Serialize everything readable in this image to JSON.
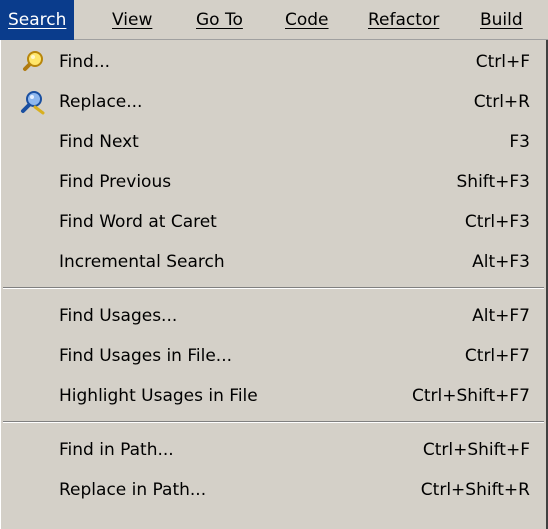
{
  "menubar": {
    "items": [
      "Search",
      "View",
      "Go To",
      "Code",
      "Refactor",
      "Build"
    ]
  },
  "menu": {
    "items": [
      {
        "label": "Find...",
        "shortcut": "Ctrl+F",
        "icon": "find-icon"
      },
      {
        "label": "Replace...",
        "shortcut": "Ctrl+R",
        "icon": "replace-icon"
      },
      {
        "label": "Find Next",
        "shortcut": "F3"
      },
      {
        "label": "Find Previous",
        "shortcut": "Shift+F3"
      },
      {
        "label": "Find Word at Caret",
        "shortcut": "Ctrl+F3"
      },
      {
        "label": "Incremental Search",
        "shortcut": "Alt+F3"
      },
      {
        "label": "Find Usages...",
        "shortcut": "Alt+F7"
      },
      {
        "label": "Find Usages in File...",
        "shortcut": "Ctrl+F7"
      },
      {
        "label": "Highlight Usages in File",
        "shortcut": "Ctrl+Shift+F7"
      },
      {
        "label": "Find in Path...",
        "shortcut": "Ctrl+Shift+F"
      },
      {
        "label": "Replace in Path...",
        "shortcut": "Ctrl+Shift+R"
      }
    ]
  },
  "colors": {
    "menu_background": "#d4d0c8",
    "active_menu_title": "#0a3c8c"
  }
}
